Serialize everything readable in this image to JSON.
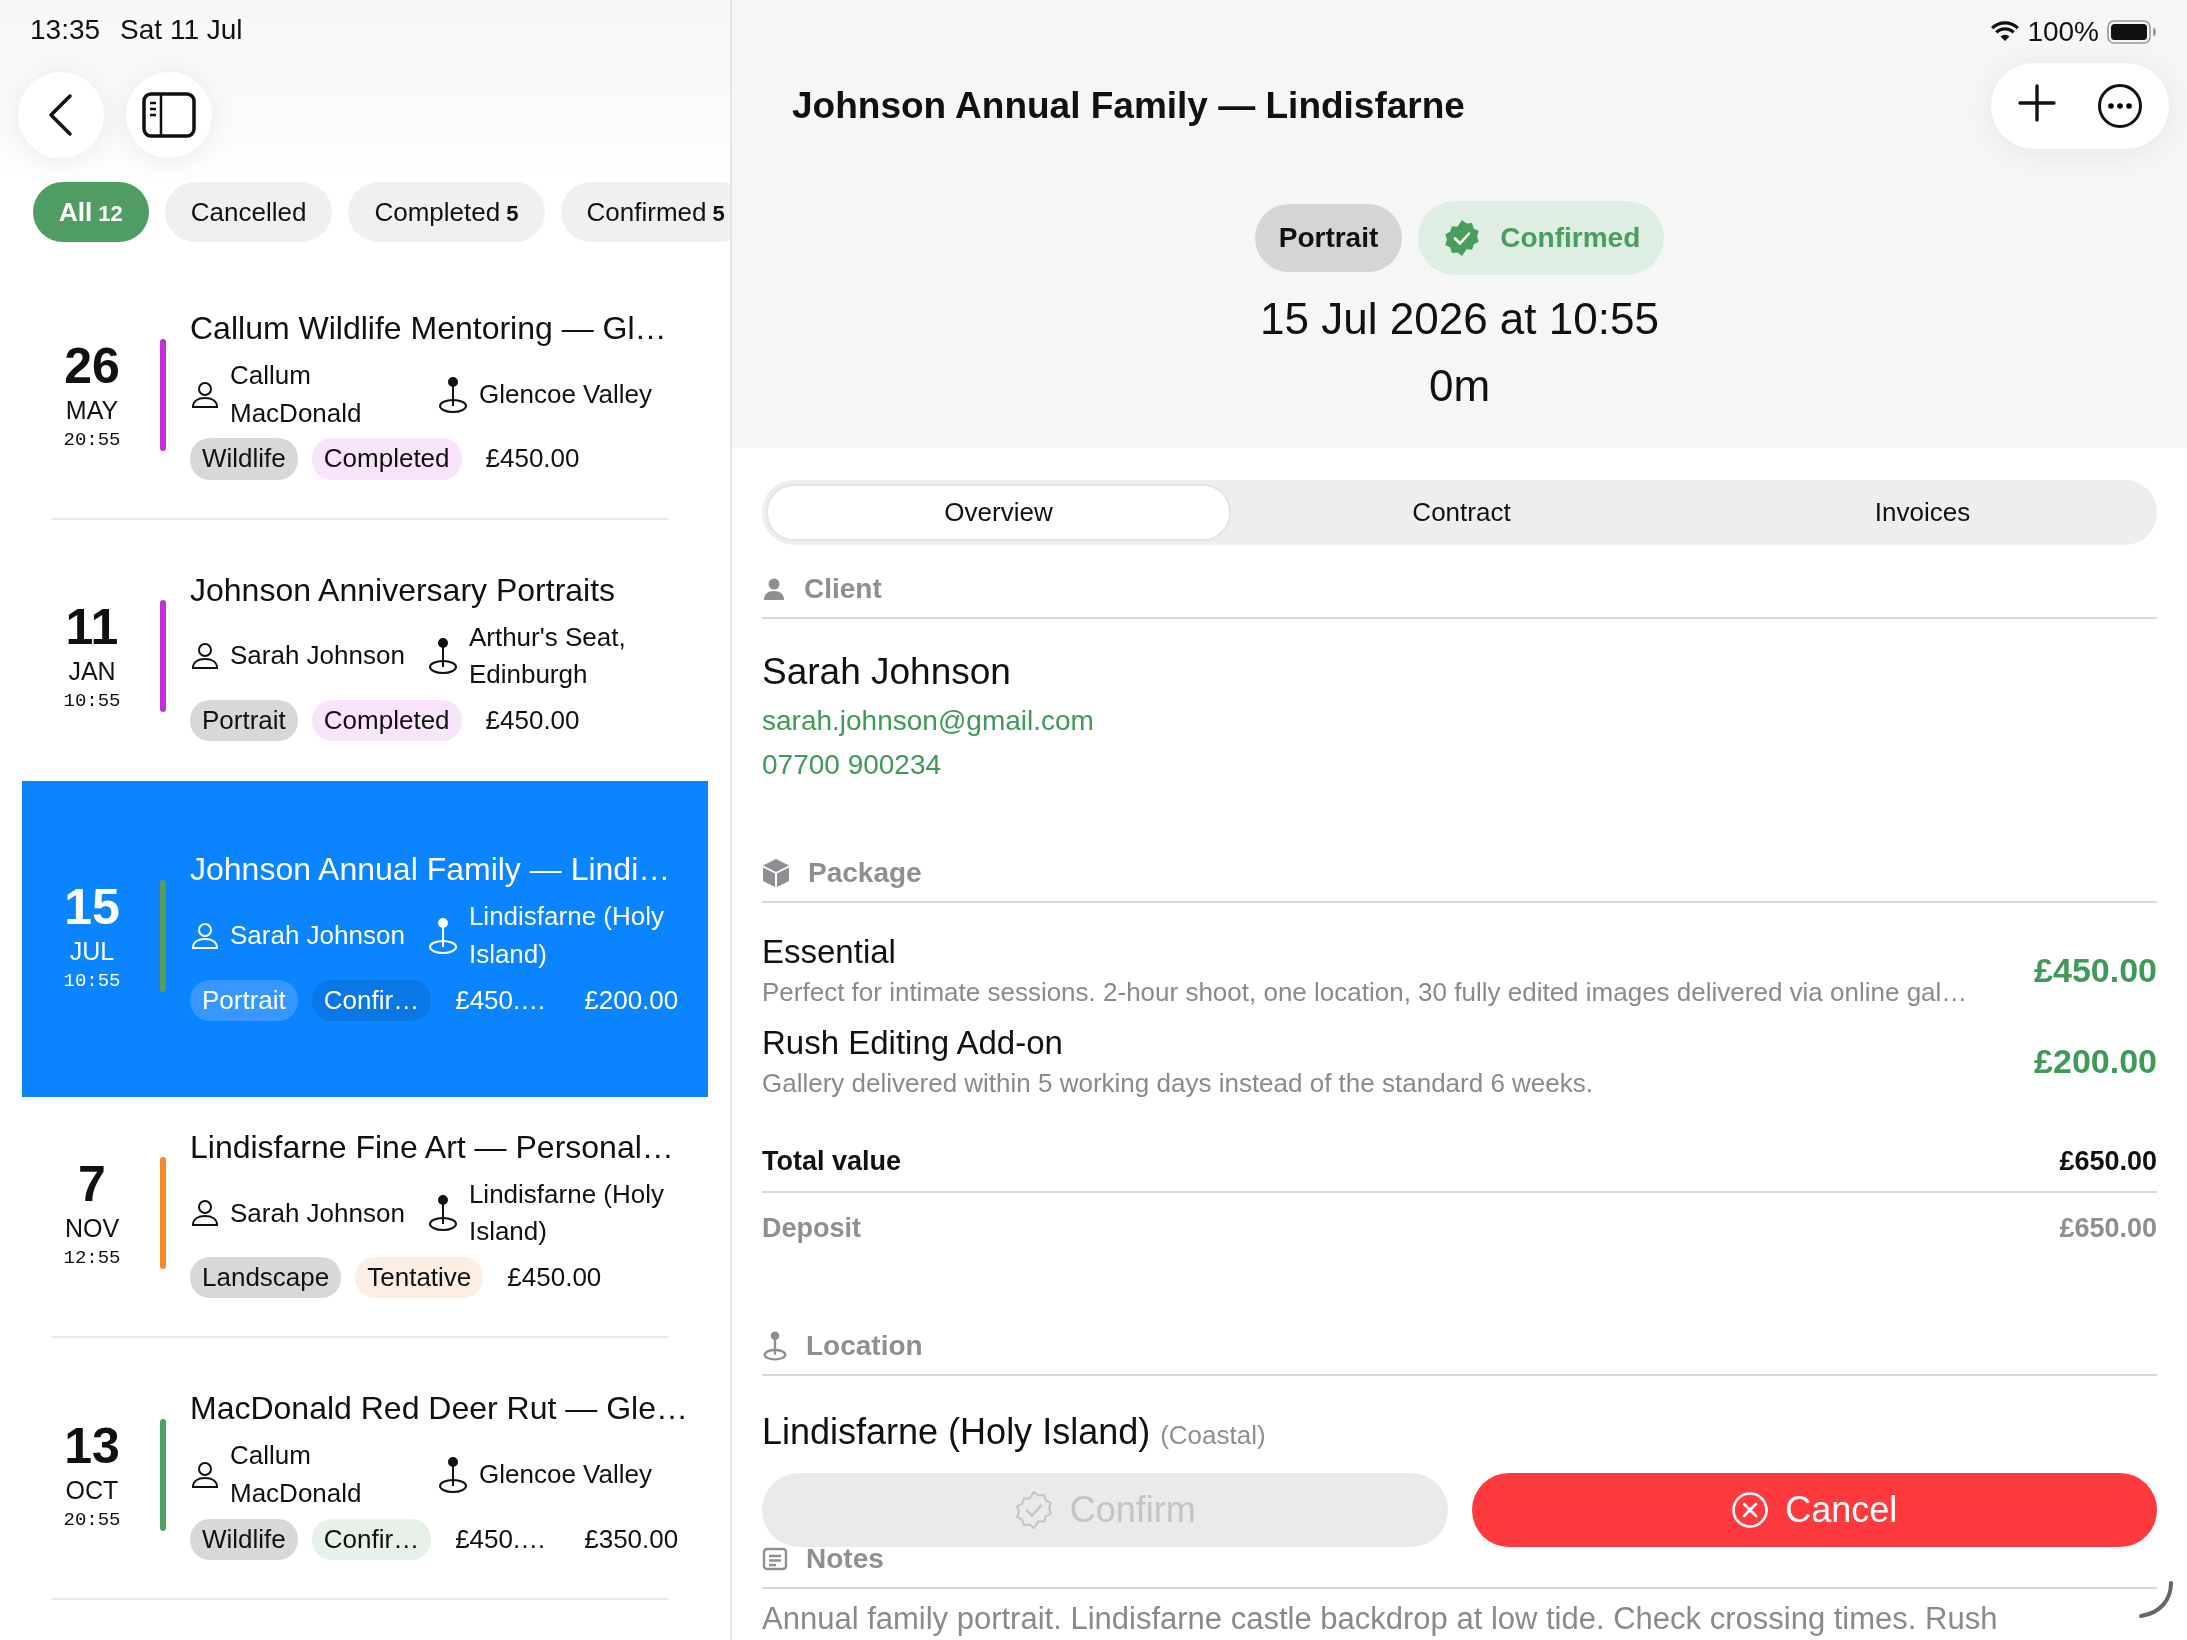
{
  "status_bar": {
    "time": "13:35",
    "date": "Sat 11 Jul",
    "battery": "100%"
  },
  "filters": [
    {
      "label": "All",
      "count": "12",
      "selected": true
    },
    {
      "label": "Cancelled",
      "selected": false
    },
    {
      "label": "Completed",
      "count": "5",
      "selected": false
    },
    {
      "label": "Confirmed",
      "count": "5",
      "selected": false
    }
  ],
  "bookings": [
    {
      "day": "26",
      "month": "MAY",
      "time": "20:55",
      "color": "#c22fd8",
      "title": "Callum Wildlife Mentoring — Gl…",
      "client": "Callum MacDonald",
      "location": "Glencoe Valley",
      "tags": [
        {
          "label": "Wildlife",
          "kind": "category"
        },
        {
          "label": "Completed",
          "kind": "status",
          "color": "#f8e4fb"
        }
      ],
      "amounts": [
        "£450.00"
      ],
      "selected": false
    },
    {
      "day": "11",
      "month": "JAN",
      "time": "10:55",
      "color": "#c22fd8",
      "title": "Johnson Anniversary Portraits",
      "client": "Sarah Johnson",
      "location": "Arthur's Seat, Edinburgh",
      "tags": [
        {
          "label": "Portrait",
          "kind": "category"
        },
        {
          "label": "Completed",
          "kind": "status",
          "color": "#f8e4fb"
        }
      ],
      "amounts": [
        "£450.00"
      ],
      "selected": false
    },
    {
      "day": "15",
      "month": "JUL",
      "time": "10:55",
      "color": "#5c9d55",
      "title": "Johnson Annual Family — Lindi…",
      "client": "Sarah Johnson",
      "location": "Lindisfarne (Holy Island)",
      "tags": [
        {
          "label": "Portrait",
          "kind": "category"
        },
        {
          "label": "Confir…",
          "kind": "status",
          "color": "#0977e6"
        }
      ],
      "amounts": [
        "£450.…",
        "£200.00"
      ],
      "selected": true
    },
    {
      "day": "7",
      "month": "NOV",
      "time": "12:55",
      "color": "#f48a2a",
      "title": "Lindisfarne Fine Art — Personal…",
      "client": "Sarah Johnson",
      "location": "Lindisfarne (Holy Island)",
      "tags": [
        {
          "label": "Landscape",
          "kind": "category"
        },
        {
          "label": "Tentative",
          "kind": "status",
          "color": "#fdeee3"
        }
      ],
      "amounts": [
        "£450.00"
      ],
      "selected": false
    },
    {
      "day": "13",
      "month": "OCT",
      "time": "20:55",
      "color": "#4aa265",
      "title": "MacDonald Red Deer Rut — Gle…",
      "client": "Callum MacDonald",
      "location": "Glencoe Valley",
      "tags": [
        {
          "label": "Wildlife",
          "kind": "category"
        },
        {
          "label": "Confir…",
          "kind": "status",
          "color": "#e6f2e9"
        }
      ],
      "amounts": [
        "£450.…",
        "£350.00"
      ],
      "selected": false
    }
  ],
  "detail": {
    "title": "Johnson Annual Family — Lindisfarne",
    "category": "Portrait",
    "status": "Confirmed",
    "datetime": "15 Jul 2026 at 10:55",
    "duration": "0m",
    "tabs": [
      {
        "label": "Overview",
        "selected": true
      },
      {
        "label": "Contract",
        "selected": false
      },
      {
        "label": "Invoices",
        "selected": false
      }
    ],
    "client": {
      "heading": "Client",
      "name": "Sarah Johnson",
      "email": "sarah.johnson@gmail.com",
      "phone": "07700 900234"
    },
    "package": {
      "heading": "Package",
      "items": [
        {
          "name": "Essential",
          "description": "Perfect for intimate sessions. 2-hour shoot, one location, 30 fully edited images delivered via online gal…",
          "price": "£450.00"
        },
        {
          "name": "Rush Editing Add-on",
          "description": "Gallery delivered within 5 working days instead of the standard 6 weeks.",
          "price": "£200.00"
        }
      ],
      "total": {
        "label": "Total value",
        "value": "£650.00"
      },
      "deposit": {
        "label": "Deposit",
        "value": "£650.00"
      }
    },
    "location": {
      "heading": "Location",
      "name": "Lindisfarne (Holy Island)",
      "type": "(Coastal)"
    },
    "actions": [
      {
        "label": "Confirm",
        "kind": "confirm",
        "disabled": true
      },
      {
        "label": "Cancel",
        "kind": "cancel",
        "disabled": false
      }
    ],
    "notes": {
      "heading": "Notes",
      "text": "Annual family portrait. Lindisfarne castle backdrop at low tide. Check crossing times. Rush"
    }
  }
}
